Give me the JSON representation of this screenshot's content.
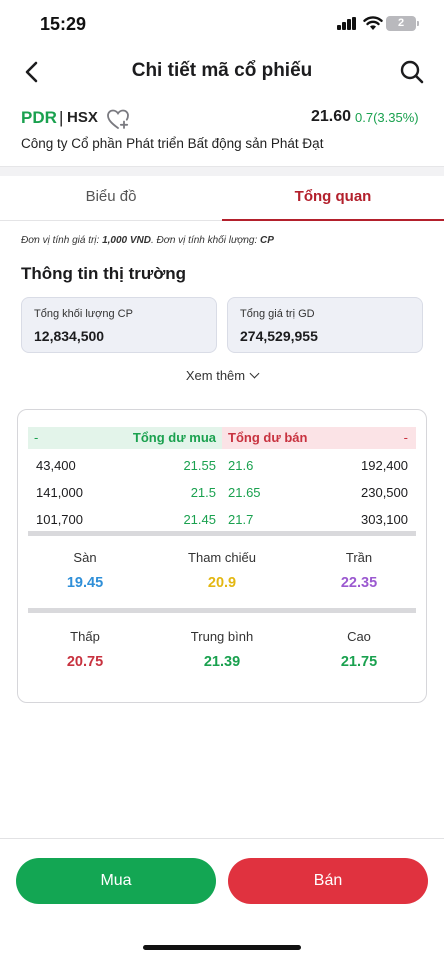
{
  "status_bar": {
    "time": "15:29",
    "battery": "2"
  },
  "nav": {
    "title": "Chi tiết mã cổ phiếu"
  },
  "stock": {
    "ticker": "PDR",
    "separator": "|",
    "exchange": "HSX",
    "price": "21.60",
    "change": "0.7(3.35%)",
    "company": "Công ty Cổ phần Phát triển Bất động sản Phát Đạt"
  },
  "tabs": [
    {
      "label": "Biểu đồ",
      "active": false
    },
    {
      "label": "Tổng quan",
      "active": true
    }
  ],
  "unit_note": {
    "price_prefix": "Đơn vị tính giá trị: ",
    "price_unit": "1,000 VND",
    "volume_prefix": ". Đơn vị tính khối lượng: ",
    "volume_unit": "CP"
  },
  "market": {
    "title": "Thông tin thị trường",
    "total_volume_label": "Tổng khối lượng CP",
    "total_volume": "12,834,500",
    "total_value_label": "Tổng giá trị GD",
    "total_value": "274,529,955",
    "see_more": "Xem thêm"
  },
  "order_book": {
    "header": {
      "buy_dash": "-",
      "buy_label": "Tổng dư mua",
      "sell_label": "Tổng dư bán",
      "sell_dash": "-"
    },
    "rows": [
      {
        "buy_vol": "43,400",
        "buy_price": "21.55",
        "sell_price": "21.6",
        "sell_vol": "192,400"
      },
      {
        "buy_vol": "141,000",
        "buy_price": "21.5",
        "sell_price": "21.65",
        "sell_vol": "230,500"
      },
      {
        "buy_vol": "101,700",
        "buy_price": "21.45",
        "sell_price": "21.7",
        "sell_vol": "303,100"
      }
    ]
  },
  "reference": {
    "floor_label": "Sàn",
    "floor": "19.45",
    "ref_label": "Tham chiếu",
    "ref": "20.9",
    "ceiling_label": "Trần",
    "ceiling": "22.35"
  },
  "session": {
    "low_label": "Thấp",
    "low": "20.75",
    "avg_label": "Trung bình",
    "avg": "21.39",
    "high_label": "Cao",
    "high": "21.75"
  },
  "actions": {
    "buy": "Mua",
    "sell": "Bán"
  },
  "colors": {
    "green": "#1aa14f",
    "red": "#c8323f",
    "floor_blue": "#2f8fd8",
    "ref_yellow": "#e3b712",
    "ceiling_purple": "#9b59d0",
    "accent_red": "#b3202c"
  }
}
